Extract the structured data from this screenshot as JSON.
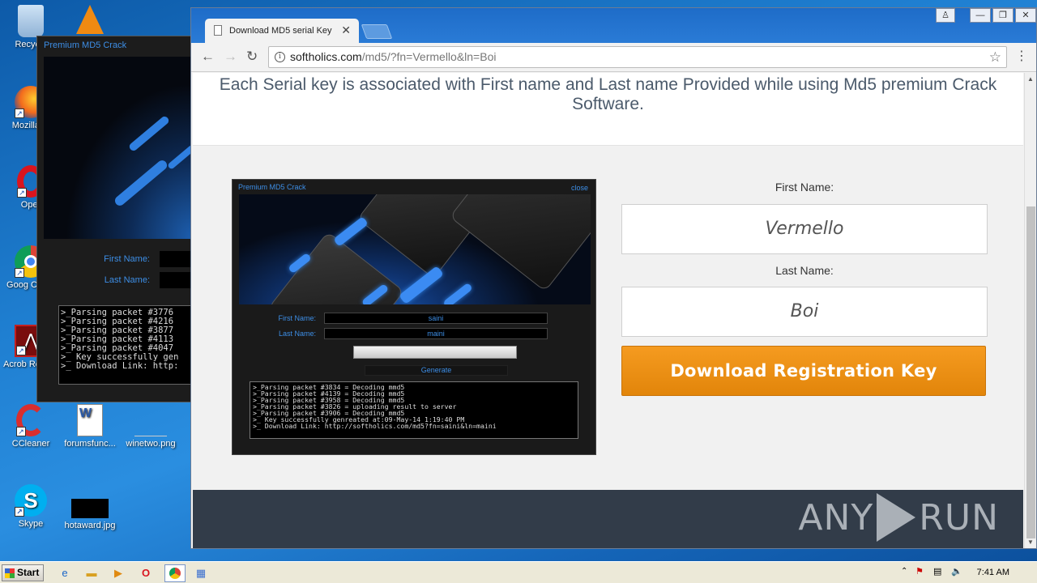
{
  "desktop": {
    "icons": [
      {
        "label": "Recycle",
        "glyph": "🗑"
      },
      {
        "label": "Mozilla Fi",
        "glyph": "🦊"
      },
      {
        "label": "Oper",
        "glyph": "O"
      },
      {
        "label": "Goog Chron",
        "glyph": "◉"
      },
      {
        "label": "Acrob Reader",
        "glyph": "A"
      },
      {
        "label": "CCleaner",
        "glyph": "C"
      },
      {
        "label": "forumsfunc...",
        "glyph": "W"
      },
      {
        "label": "winetwo.png",
        "glyph": ""
      },
      {
        "label": "Skype",
        "glyph": "S"
      },
      {
        "label": "hotaward.jpg",
        "glyph": ""
      }
    ]
  },
  "bg_crack": {
    "title": "Premium MD5  Crack",
    "first_name_label": "First Name:",
    "last_name_label": "Last Name:",
    "console": ">_Parsing packet #3776\n>_Parsing packet #4216\n>_Parsing packet #3877\n>_Parsing packet #4113\n>_Parsing packet #4047\n>_ Key successfully gen\n>_ Download Link: http:"
  },
  "browser": {
    "tab_title": "Download MD5 serial Key",
    "url_host": "softholics.com",
    "url_path": "/md5/?fn=Vermello&ln=Boi"
  },
  "page": {
    "headline": "Each Serial key is associated with First name and Last name Provided while using Md5 premium Crack Software.",
    "crack_shot": {
      "title": "Premium MD5  Crack",
      "close": "close",
      "first_name_label": "First Name:",
      "last_name_label": "Last Name:",
      "first_name_value": "saini",
      "last_name_value": "maini",
      "generate": "Generate",
      "console": ">_Parsing packet #3834 = Decoding mmd5\n>_Parsing packet #4139 = Decoding mmd5\n>_Parsing packet #3958 = Decoding mmd5\n>_Parsing packet #3826 = uploading result to server\n>_Parsing packet #3906 = Decoding mmd5\n>_ Key successfully genreated at:09-May-14 1:19:40 PM\n>_ Download Link: http://softholics.com/md5?fn=saini&ln=maini"
    },
    "form": {
      "first_name_label": "First Name:",
      "first_name_value": "Vermello",
      "last_name_label": "Last Name:",
      "last_name_value": "Boi",
      "download_button": "Download Registration Key"
    },
    "watermark": {
      "left": "ANY",
      "right": "RUN"
    }
  },
  "taskbar": {
    "start": "Start",
    "clock": "7:41 AM"
  },
  "colors": {
    "accent_orange": "#f0931a",
    "crack_blue": "#3d8ee6",
    "footer": "#323c49"
  }
}
